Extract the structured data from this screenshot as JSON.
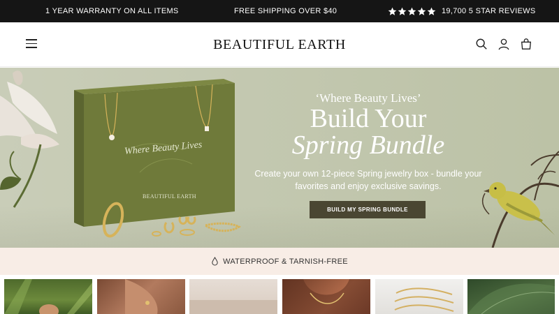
{
  "announcement": {
    "warranty": "1 YEAR WARRANTY ON ALL ITEMS",
    "shipping": "FREE SHIPPING OVER $40",
    "rating_stars": 5,
    "reviews": "19,700 5 STAR REVIEWS"
  },
  "header": {
    "logo": "BEAUTIFUL EARTH",
    "icons": [
      "menu-icon",
      "search-icon",
      "account-icon",
      "cart-icon"
    ]
  },
  "hero": {
    "eyebrow": "‘Where Beauty Lives’",
    "title_line1": "Build Your",
    "title_line2": "Spring Bundle",
    "subtitle_line1": "Create your own 12-piece Spring jewelry box - bundle your",
    "subtitle_line2": "favorites and enjoy exclusive savings.",
    "cta": "BUILD MY SPRING BUNDLE",
    "box_script": "Where Beauty Lives",
    "box_brand": "BEAUTIFUL EARTH"
  },
  "feature": {
    "icon": "water-drop-icon",
    "label": "WATERPROOF & TARNISH-FREE"
  },
  "colors": {
    "announcement_bg": "#151515",
    "hero_bg": "#c3c8b0",
    "box_green": "#6f7a3a",
    "cta_bg": "#4a4632",
    "feature_bg": "#f8ede6",
    "gold": "#d6b35a"
  }
}
